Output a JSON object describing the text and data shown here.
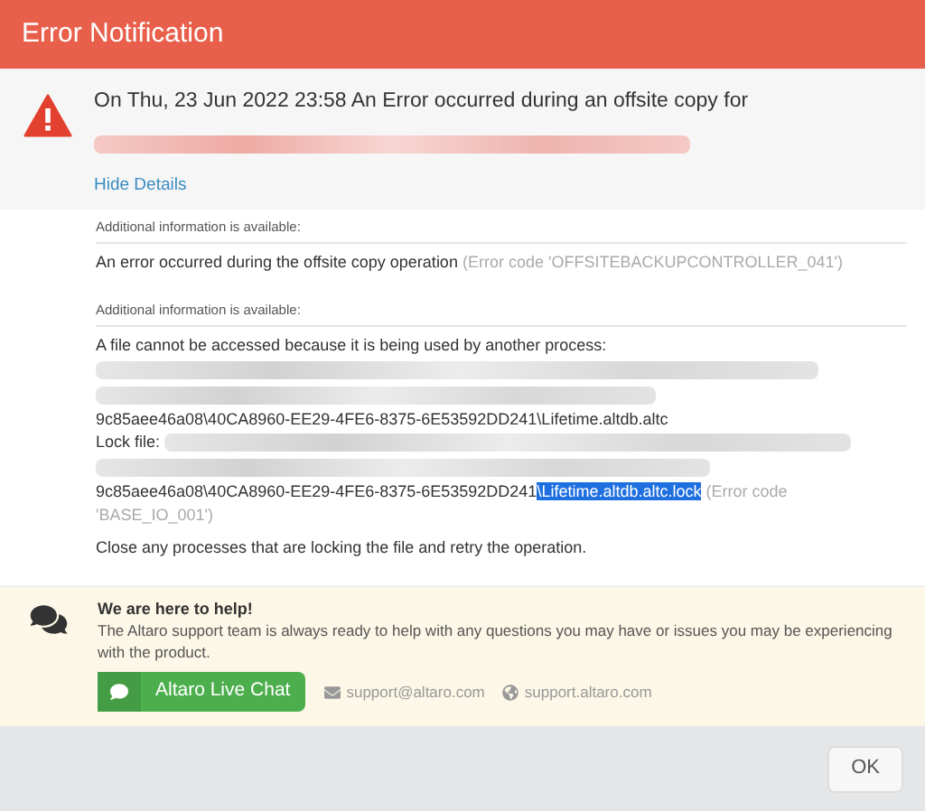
{
  "window": {
    "title": "Error Notification"
  },
  "header": {
    "message": "On Thu, 23 Jun 2022 23:58 An Error occurred during an offsite copy for",
    "toggle_link": "Hide Details"
  },
  "details": [
    {
      "heading": "Additional information is available:",
      "lines": [
        [
          {
            "kind": "text",
            "text": "An error occurred during the offsite copy operation"
          },
          {
            "kind": "code",
            "text": "(Error code 'OFFSITEBACKUPCONTROLLER_041')"
          }
        ]
      ]
    },
    {
      "heading": "Additional information is available:",
      "lines": [
        [
          {
            "kind": "text",
            "text": "A file cannot be accessed because it is being used by another process:"
          }
        ],
        [
          {
            "kind": "redacted"
          }
        ],
        [
          {
            "kind": "redacted"
          }
        ],
        [
          {
            "kind": "text",
            "text": "9c85aee46a08\\40CA8960-EE29-4FE6-8375-6E53592DD241\\Lifetime.altdb.altc"
          }
        ],
        [
          {
            "kind": "text",
            "text": "Lock file:"
          },
          {
            "kind": "redacted"
          }
        ],
        [
          {
            "kind": "redacted"
          }
        ],
        [
          {
            "kind": "text",
            "text": "9c85aee46a08\\40CA8960-EE29-4FE6-8375-6E53592DD241"
          },
          {
            "kind": "selection",
            "text": "\\Lifetime.altdb.altc.lock"
          },
          {
            "kind": "code",
            "text": "(Error code"
          }
        ],
        [
          {
            "kind": "code",
            "text": "'BASE_IO_001')"
          }
        ],
        [
          {
            "kind": "gap"
          }
        ],
        [
          {
            "kind": "text",
            "text": "Close any processes that are locking the file and retry the operation."
          }
        ]
      ]
    }
  ],
  "help": {
    "title": "We are here to help!",
    "body": "The Altaro support team is always ready to help with any questions you may have or issues you may be experiencing with the product.",
    "chat_button": "Altaro Live Chat",
    "email": "support@altaro.com",
    "website": "support.altaro.com"
  },
  "buttons": [
    "OK"
  ]
}
